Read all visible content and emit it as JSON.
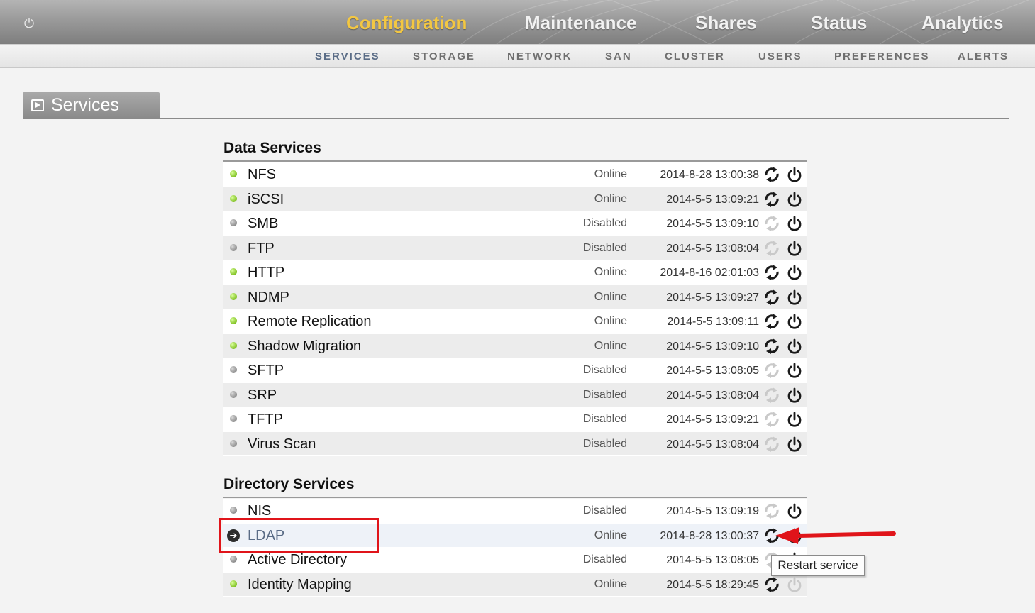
{
  "header": {
    "tabs": [
      {
        "label": "Configuration",
        "active": true
      },
      {
        "label": "Maintenance",
        "active": false
      },
      {
        "label": "Shares",
        "active": false
      },
      {
        "label": "Status",
        "active": false
      },
      {
        "label": "Analytics",
        "active": false
      }
    ],
    "power_icon": "power-icon",
    "active_color": "#f3c742"
  },
  "subnav": {
    "items": [
      {
        "label": "SERVICES",
        "active": true
      },
      {
        "label": "STORAGE",
        "active": false
      },
      {
        "label": "NETWORK",
        "active": false
      },
      {
        "label": "SAN",
        "active": false
      },
      {
        "label": "CLUSTER",
        "active": false
      },
      {
        "label": "USERS",
        "active": false
      },
      {
        "label": "PREFERENCES",
        "active": false
      },
      {
        "label": "ALERTS",
        "active": false
      }
    ]
  },
  "page": {
    "section_title": "Services"
  },
  "groups": [
    {
      "title": "Data Services",
      "services": [
        {
          "name": "NFS",
          "status": "Online",
          "time": "2014-8-28 13:00:38"
        },
        {
          "name": "iSCSI",
          "status": "Online",
          "time": "2014-5-5 13:09:21"
        },
        {
          "name": "SMB",
          "status": "Disabled",
          "time": "2014-5-5 13:09:10"
        },
        {
          "name": "FTP",
          "status": "Disabled",
          "time": "2014-5-5 13:08:04"
        },
        {
          "name": "HTTP",
          "status": "Online",
          "time": "2014-8-16 02:01:03"
        },
        {
          "name": "NDMP",
          "status": "Online",
          "time": "2014-5-5 13:09:27"
        },
        {
          "name": "Remote Replication",
          "status": "Online",
          "time": "2014-5-5 13:09:11"
        },
        {
          "name": "Shadow Migration",
          "status": "Online",
          "time": "2014-5-5 13:09:10"
        },
        {
          "name": "SFTP",
          "status": "Disabled",
          "time": "2014-5-5 13:08:05"
        },
        {
          "name": "SRP",
          "status": "Disabled",
          "time": "2014-5-5 13:08:04"
        },
        {
          "name": "TFTP",
          "status": "Disabled",
          "time": "2014-5-5 13:09:21"
        },
        {
          "name": "Virus Scan",
          "status": "Disabled",
          "time": "2014-5-5 13:08:04"
        }
      ]
    },
    {
      "title": "Directory Services",
      "services": [
        {
          "name": "NIS",
          "status": "Disabled",
          "time": "2014-5-5 13:09:19"
        },
        {
          "name": "LDAP",
          "status": "Online",
          "time": "2014-8-28 13:00:37",
          "highlighted": true
        },
        {
          "name": "Active Directory",
          "status": "Disabled",
          "time": "2014-5-5 13:08:05"
        },
        {
          "name": "Identity Mapping",
          "status": "Online",
          "time": "2014-5-5 18:29:45"
        }
      ]
    }
  ],
  "tooltip": {
    "text": "Restart service"
  },
  "colors": {
    "online_dot": "#7fc021",
    "disabled_dot": "#8c8c8c",
    "annotation_red": "#e0141a"
  }
}
